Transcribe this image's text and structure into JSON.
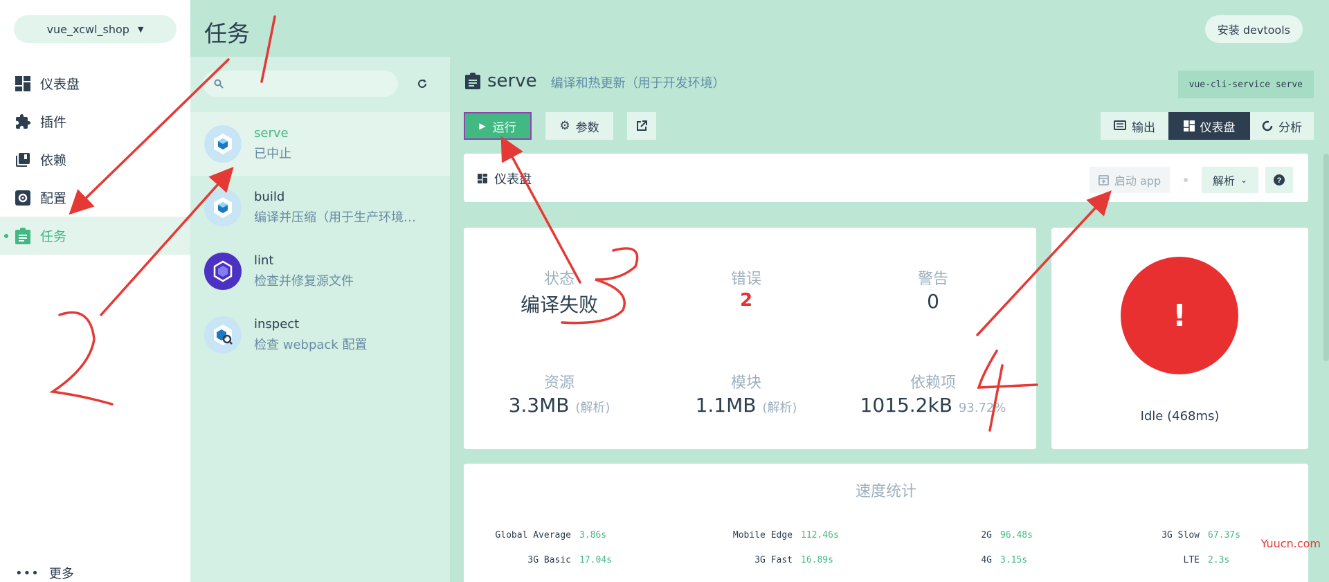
{
  "project": {
    "name": "vue_xcwl_shop"
  },
  "nav": {
    "items": [
      {
        "label": "仪表盘",
        "icon": "dashboard-icon"
      },
      {
        "label": "插件",
        "icon": "puzzle-icon"
      },
      {
        "label": "依赖",
        "icon": "library-icon"
      },
      {
        "label": "配置",
        "icon": "settings-icon"
      },
      {
        "label": "任务",
        "icon": "assignment-icon",
        "active": true
      }
    ],
    "more": "更多"
  },
  "header": {
    "title": "任务",
    "devtools": "安装 devtools"
  },
  "search": {
    "placeholder": ""
  },
  "tasks": [
    {
      "name": "serve",
      "desc": "已中止",
      "active": true
    },
    {
      "name": "build",
      "desc": "编译并压缩（用于生产环境…"
    },
    {
      "name": "lint",
      "desc": "检查并修复源文件"
    },
    {
      "name": "inspect",
      "desc": "检查 webpack 配置"
    }
  ],
  "task_detail": {
    "name": "serve",
    "desc": "编译和热更新（用于开发环境）",
    "command": "vue-cli-service serve",
    "run": "运行",
    "params": "参数",
    "tabs": {
      "output": "输出",
      "dashboard": "仪表盘",
      "analysis": "分析"
    }
  },
  "dashboard": {
    "title": "仪表盘",
    "start_app": "启动 app",
    "analyze": "解析",
    "stats": {
      "status_label": "状态",
      "status_value": "编译失败",
      "errors_label": "错误",
      "errors_value": "2",
      "warnings_label": "警告",
      "warnings_value": "0",
      "assets_label": "资源",
      "assets_value": "3.3MB",
      "assets_sub": "(解析)",
      "modules_label": "模块",
      "modules_value": "1.1MB",
      "modules_sub": "(解析)",
      "deps_label": "依赖项",
      "deps_value": "1015.2kB",
      "deps_sub": "93.72%"
    },
    "status_symbol": "!",
    "status_text": "Idle (468ms)"
  },
  "speed": {
    "title": "速度统计",
    "row1": [
      {
        "k": "Global Average",
        "v": "3.86s"
      },
      {
        "k": "Mobile Edge",
        "v": "112.46s"
      },
      {
        "k": "2G",
        "v": "96.48s"
      },
      {
        "k": "3G Slow",
        "v": "67.37s"
      }
    ],
    "row2": [
      {
        "k": "3G Basic",
        "v": "17.04s"
      },
      {
        "k": "3G Fast",
        "v": "16.89s"
      },
      {
        "k": "4G",
        "v": "3.15s"
      },
      {
        "k": "LTE",
        "v": "2.3s"
      }
    ]
  },
  "watermark": "Yuucn.com",
  "annotations": {
    "mark1": "1",
    "mark2": "2",
    "mark3": "3",
    "mark4": "4"
  },
  "colors": {
    "accent": "#42b983",
    "dark": "#2c3e50",
    "error": "#e83030",
    "annotation": "#e53935"
  }
}
